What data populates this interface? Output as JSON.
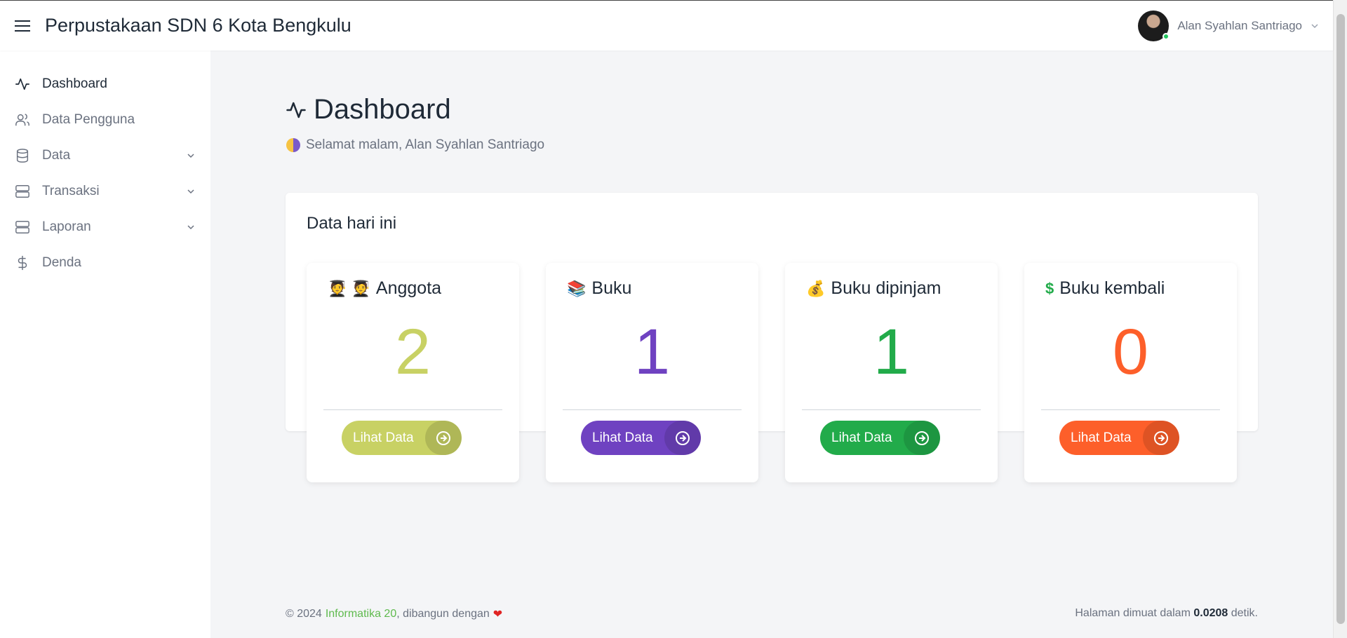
{
  "header": {
    "title": "Perpustakaan SDN 6 Kota Bengkulu",
    "user_name": "Alan Syahlan Santriago"
  },
  "sidebar": {
    "items": [
      {
        "label": "Dashboard",
        "icon": "activity-icon",
        "active": true
      },
      {
        "label": "Data Pengguna",
        "icon": "users-icon"
      },
      {
        "label": "Data",
        "icon": "database-icon",
        "expandable": true
      },
      {
        "label": "Transaksi",
        "icon": "server-icon",
        "expandable": true
      },
      {
        "label": "Laporan",
        "icon": "server-icon",
        "expandable": true
      },
      {
        "label": "Denda",
        "icon": "dollar-icon"
      }
    ]
  },
  "main": {
    "title": "Dashboard",
    "greeting": "Selamat malam, Alan Syahlan Santriago",
    "panel_title": "Data hari ini",
    "cards": [
      {
        "title": "Anggota",
        "emoji": "🧑‍🎓 🧑‍🎓",
        "value": "2",
        "button": "Lihat Data",
        "color": "#c8d164",
        "value_color": "#c8d164"
      },
      {
        "title": "Buku",
        "emoji": "📚",
        "value": "1",
        "button": "Lihat Data",
        "color": "#6f42c1",
        "value_color": "#6f42c1"
      },
      {
        "title": "Buku dipinjam",
        "emoji": "💰",
        "value": "1",
        "button": "Lihat Data",
        "color": "#22ab4a",
        "value_color": "#22ab4a"
      },
      {
        "title": "Buku kembali",
        "emoji": "$",
        "value": "0",
        "button": "Lihat Data",
        "color": "#fd5f2a",
        "value_color": "#fd5f2a"
      }
    ]
  },
  "footer": {
    "copyright": "© 2024",
    "link_text": "Informatika 20",
    "built_with": ", dibangun dengan",
    "load_prefix": "Halaman dimuat dalam",
    "load_time": "0.0208",
    "load_suffix": "detik."
  }
}
